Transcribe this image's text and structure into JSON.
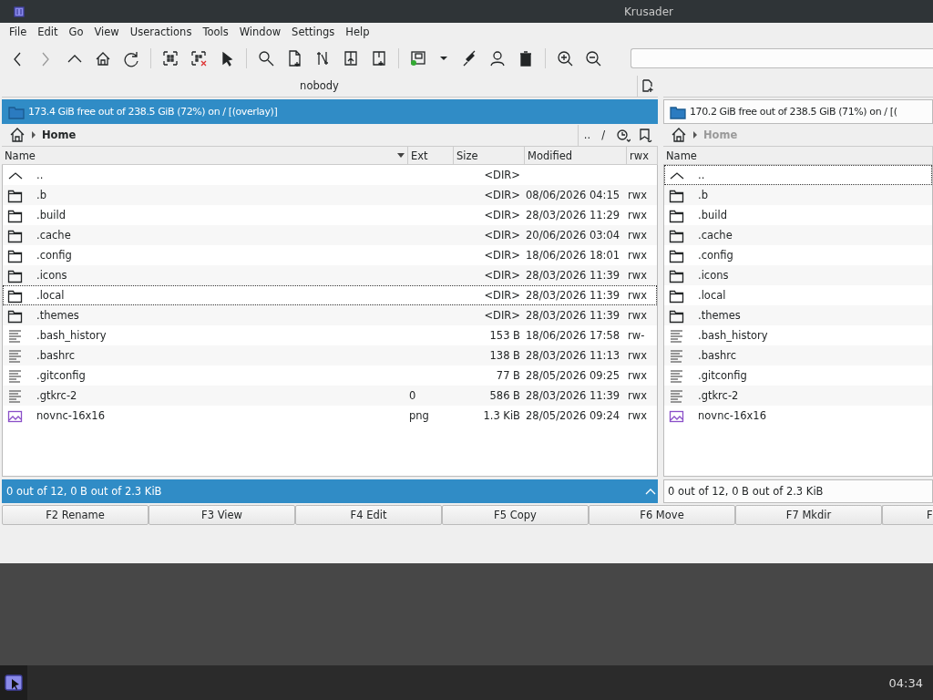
{
  "window": {
    "title": "Krusader"
  },
  "menu": [
    "File",
    "Edit",
    "Go",
    "View",
    "Useractions",
    "Tools",
    "Window",
    "Settings",
    "Help"
  ],
  "panels": [
    {
      "active": true,
      "tab": "nobody",
      "free_space": "173.4 GiB free out of 238.5 GiB (72%) on / [(overlay)]",
      "breadcrumb": "Home",
      "nav_buttons": [
        "..",
        "/"
      ],
      "columns": [
        {
          "label": "Name",
          "sorted": true
        },
        {
          "label": "Ext",
          "sorted": false
        },
        {
          "label": "Size",
          "sorted": false
        },
        {
          "label": "Modified",
          "sorted": false
        },
        {
          "label": "rwx",
          "sorted": false
        }
      ],
      "rows": [
        {
          "kind": "up",
          "name": "..",
          "size": "<DIR>",
          "current": false
        },
        {
          "kind": "dir",
          "name": ".b",
          "size": "<DIR>",
          "modified": "08/06/2026 04:15",
          "perms": "rwx",
          "current": false
        },
        {
          "kind": "dir",
          "name": ".build",
          "size": "<DIR>",
          "modified": "28/03/2026 11:29",
          "perms": "rwx",
          "current": false
        },
        {
          "kind": "dir",
          "name": ".cache",
          "size": "<DIR>",
          "modified": "20/06/2026 03:04",
          "perms": "rwx",
          "current": false
        },
        {
          "kind": "dir",
          "name": ".config",
          "size": "<DIR>",
          "modified": "18/06/2026 18:01",
          "perms": "rwx",
          "current": false
        },
        {
          "kind": "dir",
          "name": ".icons",
          "size": "<DIR>",
          "modified": "28/03/2026 11:39",
          "perms": "rwx",
          "current": false
        },
        {
          "kind": "dir",
          "name": ".local",
          "size": "<DIR>",
          "modified": "28/03/2026 11:39",
          "perms": "rwx",
          "current": true
        },
        {
          "kind": "dir",
          "name": ".themes",
          "size": "<DIR>",
          "modified": "28/03/2026 11:39",
          "perms": "rwx",
          "current": false
        },
        {
          "kind": "file",
          "name": ".bash_history",
          "size": "153 B",
          "modified": "18/06/2026 17:58",
          "perms": "rw-",
          "current": false
        },
        {
          "kind": "file",
          "name": ".bashrc",
          "size": "138 B",
          "modified": "28/03/2026 11:13",
          "perms": "rwx",
          "current": false
        },
        {
          "kind": "file",
          "name": ".gitconfig",
          "size": "77 B",
          "modified": "28/05/2026 09:25",
          "perms": "rwx",
          "current": false
        },
        {
          "kind": "file",
          "name": ".gtkrc-2",
          "ext": "0",
          "size": "586 B",
          "modified": "28/03/2026 11:39",
          "perms": "rwx",
          "current": false
        },
        {
          "kind": "image",
          "name": "novnc-16x16",
          "ext": "png",
          "size": "1.3 KiB",
          "modified": "28/05/2026 09:24",
          "perms": "rwx",
          "current": false
        }
      ],
      "status": "0 out of 12, 0 B out of 2.3 KiB"
    },
    {
      "active": false,
      "free_space": "170.2 GiB free out of 238.5 GiB (71%) on / [(",
      "breadcrumb": "Home",
      "columns": [
        {
          "label": "Name",
          "sorted": false
        }
      ],
      "rows": [
        {
          "kind": "up",
          "name": "..",
          "current": true
        },
        {
          "kind": "dir",
          "name": ".b",
          "current": false
        },
        {
          "kind": "dir",
          "name": ".build",
          "current": false
        },
        {
          "kind": "dir",
          "name": ".cache",
          "current": false
        },
        {
          "kind": "dir",
          "name": ".config",
          "current": false
        },
        {
          "kind": "dir",
          "name": ".icons",
          "current": false
        },
        {
          "kind": "dir",
          "name": ".local",
          "current": false
        },
        {
          "kind": "dir",
          "name": ".themes",
          "current": false
        },
        {
          "kind": "file",
          "name": ".bash_history",
          "current": false
        },
        {
          "kind": "file",
          "name": ".bashrc",
          "current": false
        },
        {
          "kind": "file",
          "name": ".gitconfig",
          "current": false
        },
        {
          "kind": "file",
          "name": ".gtkrc-2",
          "current": false
        },
        {
          "kind": "image",
          "name": "novnc-16x16",
          "current": false
        }
      ],
      "status": "0 out of 12, 0 B out of 2.3 KiB"
    }
  ],
  "function_keys": [
    "F2 Rename",
    "F3 View",
    "F4 Edit",
    "F5 Copy",
    "F6 Move",
    "F7 Mkdir",
    "F"
  ],
  "taskbar": {
    "clock": "04:34"
  }
}
